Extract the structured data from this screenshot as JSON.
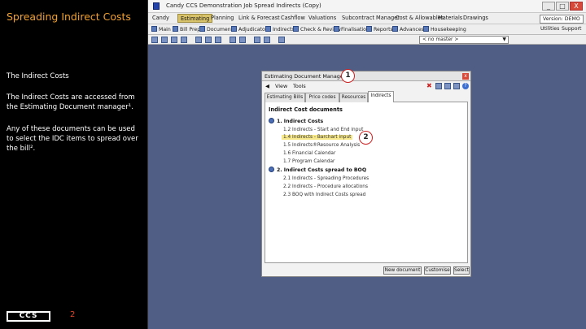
{
  "slide": {
    "title": "Spreading Indirect Costs",
    "paragraphs": [
      "The Indirect Costs",
      "The Indirect Costs are accessed from the Estimating Document manager¹.",
      "Any of these documents can be used to select the IDC items to spread over the bill².",
      ""
    ],
    "logo_text": "CCS",
    "page_number": "2"
  },
  "app": {
    "title": "Candy   CCS Demonstration Job   Spread Indirects (Copy)",
    "window_buttons": {
      "min": "_",
      "max": "□",
      "close": "X"
    },
    "menu": [
      "Candy",
      "Estimating",
      "Planning",
      "Link & Forecast",
      "Cashflow",
      "Valuations",
      "Subcontract Manager",
      "Cost & Allowables",
      "Materials",
      "Drawings"
    ],
    "active_menu": "Estimating",
    "version": "Version: DEMO",
    "toolbar": [
      "Main",
      "Bill Prep",
      "Documents",
      "Adjudicators",
      "Indirects",
      "Check & Review",
      "Finalisation",
      "Reports",
      "Advances",
      "Housekeeping"
    ],
    "master_select": "< no master >",
    "utilities": "Utilities",
    "support": "Support"
  },
  "dialog": {
    "title": "Estimating Document Manager",
    "close": "x",
    "menu": [
      "View",
      "Tools"
    ],
    "tabs": [
      "Estimating Bills",
      "Price codes",
      "Resources",
      "Indirects"
    ],
    "selected_tab": "Indirects",
    "heading": "Indirect Cost documents",
    "groups": [
      {
        "label": "1. Indirect Costs",
        "items": [
          "1.2 Indirects - Start and End input",
          "1.4 Indirects - Barchart input",
          "1.5 Indirects®Resource Analysis",
          "1.6 Financial Calendar",
          "1.7 Program Calendar"
        ]
      },
      {
        "label": "2. Indirect Costs spread to BOQ",
        "items": [
          "2.1 Indirects - Spreading Procedures",
          "2.2 Indirects - Procedure allocations",
          "2.3 BOQ with Indirect Costs spread"
        ]
      }
    ],
    "highlighted_item": "1.4 Indirects - Barchart input",
    "buttons": [
      "New document",
      "Customise",
      "Select"
    ]
  },
  "callouts": [
    "1",
    "2"
  ]
}
